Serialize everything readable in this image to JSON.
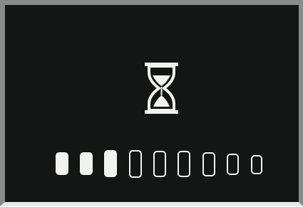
{
  "screen": {
    "background": "#141615",
    "foreground": "#f2f3f0",
    "status_icon": "hourglass-icon"
  },
  "progress": {
    "total_segments": 9,
    "filled_segments": 3,
    "fraction": 0.333
  }
}
